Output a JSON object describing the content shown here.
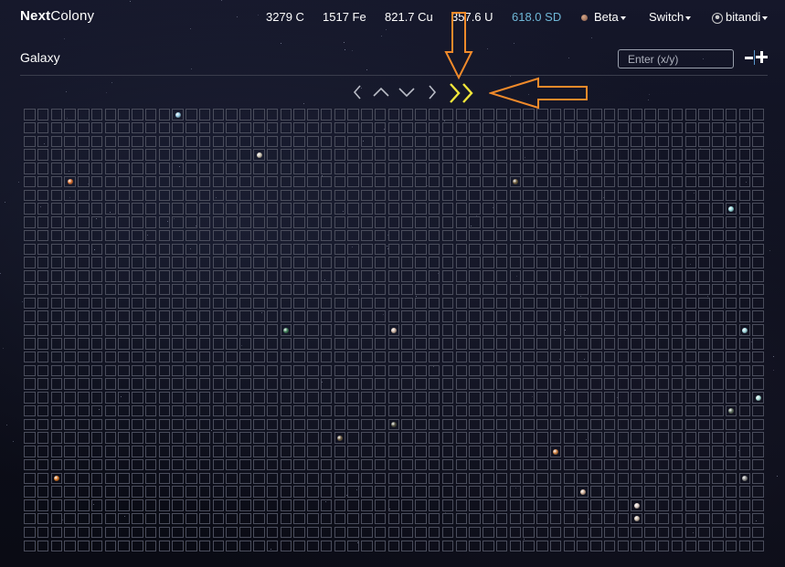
{
  "header": {
    "brand_bold": "Next",
    "brand_rest": "Colony",
    "resources": {
      "coal": "3279 C",
      "iron": "1517 Fe",
      "copper": "821.7 Cu",
      "uranium": "357.6 U",
      "sd": "618.0 SD"
    },
    "planet_menu_label": "Beta",
    "switch_menu_label": "Switch",
    "user_menu_label": "bitandi",
    "icons": [
      "planet-icon",
      "user-icon",
      "caret-down-icon"
    ]
  },
  "page": {
    "title": "Galaxy",
    "coord_input_placeholder": "Enter (x/y)",
    "zoom_out_icon": "minus-icon",
    "zoom_in_icon": "plus-icon"
  },
  "navigation": {
    "buttons": [
      "chevron-left-icon",
      "chevron-up-icon",
      "chevron-down-icon",
      "chevron-right-icon",
      "double-chevron-right-icon"
    ],
    "highlighted": "double-chevron-right-icon",
    "highlight_color": "#f0e63a",
    "annotation_arrow_color": "#f08a2a"
  },
  "grid": {
    "columns": 55,
    "rows": 33,
    "planets": [
      {
        "col": 11,
        "row": 0,
        "color": "#8fc4e0"
      },
      {
        "col": 17,
        "row": 3,
        "color": "#c9c1b0"
      },
      {
        "col": 3,
        "row": 5,
        "color": "#d46a2a"
      },
      {
        "col": 36,
        "row": 5,
        "color": "#6b5a3a"
      },
      {
        "col": 52,
        "row": 7,
        "color": "#8fd3d8"
      },
      {
        "col": 19,
        "row": 16,
        "color": "#3a7a55"
      },
      {
        "col": 27,
        "row": 16,
        "color": "#c9b0a0"
      },
      {
        "col": 53,
        "row": 16,
        "color": "#9fd8e0"
      },
      {
        "col": 54,
        "row": 21,
        "color": "#a8dcd8"
      },
      {
        "col": 52,
        "row": 22,
        "color": "#5a6a5a"
      },
      {
        "col": 27,
        "row": 23,
        "color": "#4a4a3a"
      },
      {
        "col": 23,
        "row": 24,
        "color": "#6a5a40"
      },
      {
        "col": 39,
        "row": 25,
        "color": "#c97a3a"
      },
      {
        "col": 2,
        "row": 27,
        "color": "#d4701e"
      },
      {
        "col": 53,
        "row": 27,
        "color": "#8a8a8a"
      },
      {
        "col": 41,
        "row": 28,
        "color": "#c9a890"
      },
      {
        "col": 45,
        "row": 29,
        "color": "#d8c8c0"
      },
      {
        "col": 45,
        "row": 30,
        "color": "#c8b8a8"
      }
    ]
  }
}
